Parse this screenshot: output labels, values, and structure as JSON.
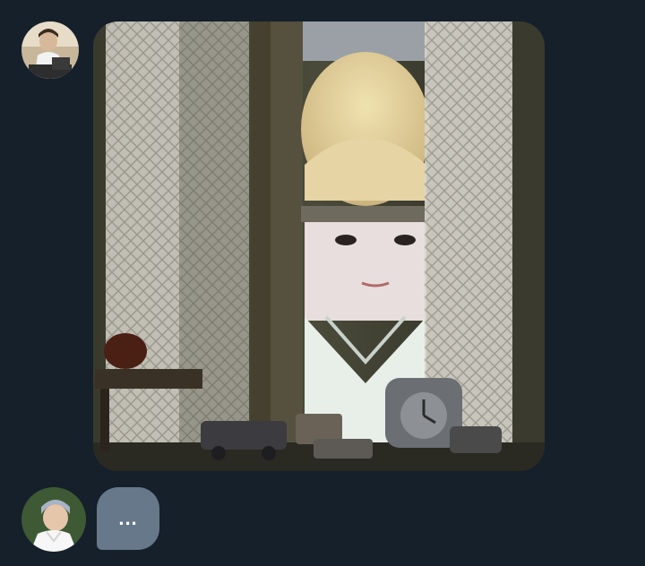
{
  "conversation": {
    "incoming_image": {
      "sender_avatar_icon": "user-avatar-icon",
      "image_icon": "window-peek-photo"
    },
    "typing": {
      "sender_avatar_icon": "user-avatar-icon",
      "indicator_text": "..."
    }
  },
  "colors": {
    "background": "#15202b",
    "typing_bubble": "#66788a",
    "typing_text": "#ffffff"
  }
}
